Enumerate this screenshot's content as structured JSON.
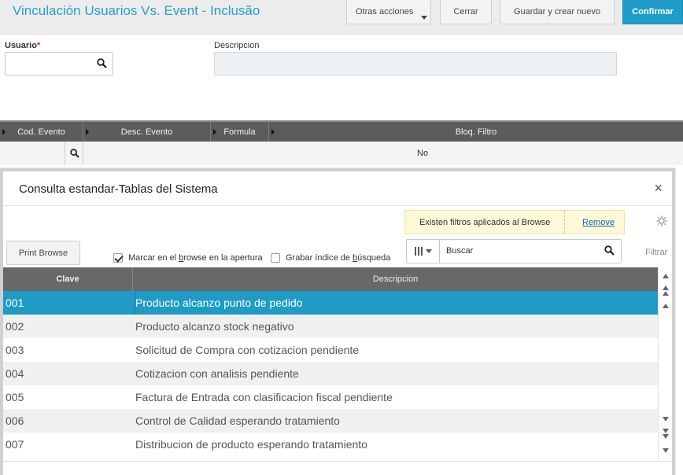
{
  "header": {
    "title": "Vinculación Usuarios Vs. Event - Inclusão",
    "buttons": {
      "more": "Otras acciones",
      "close": "Cerrar",
      "save_new": "Guardar y crear nuevo",
      "confirm": "Confirmar"
    },
    "accent_color": "#1e9dc8"
  },
  "form": {
    "usuario_label": "Usuario",
    "required_mark": "*",
    "usuario_value": "",
    "descripcion_label": "Descripcion",
    "descripcion_value": ""
  },
  "grid": {
    "columns": [
      "Cod. Evento",
      "Desc. Evento",
      "Formula",
      "Bloq. Filtro"
    ],
    "row": {
      "bloq_filtro": "No"
    }
  },
  "modal": {
    "title": "Consulta estandar-Tablas del Sistema",
    "close_glyph": "×",
    "filter_notice": "Existen filtros aplicados al Browse",
    "remove_link": "Remove",
    "print_browse": "Print Browse",
    "checkbox_mark_pre": "Marcar en el ",
    "checkbox_mark_u": "b",
    "checkbox_mark_post": "rowse en la apertura",
    "checkbox_mark_checked": true,
    "checkbox_index_pre": "Grabar índice de ",
    "checkbox_index_u": "b",
    "checkbox_index_post": "úsqueda",
    "checkbox_index_checked": false,
    "search_value": "Buscar",
    "filtrar": "Filtrar",
    "table": {
      "headers": {
        "clave": "Clave",
        "descripcion": "Descripcion"
      },
      "rows": [
        {
          "clave": "001",
          "descripcion": "Producto alcanzo punto de pedido"
        },
        {
          "clave": "002",
          "descripcion": "Producto alcanzo stock negativo"
        },
        {
          "clave": "003",
          "descripcion": "Solicitud de Compra con cotizacion pendiente"
        },
        {
          "clave": "004",
          "descripcion": "Cotizacion con analisis pendiente"
        },
        {
          "clave": "005",
          "descripcion": "Factura de Entrada con clasificacion fiscal pendiente"
        },
        {
          "clave": "006",
          "descripcion": "Control de Calidad esperando tratamiento"
        },
        {
          "clave": "007",
          "descripcion": "Distribucion de producto esperando tratamiento"
        }
      ],
      "selected_row": 0
    }
  }
}
